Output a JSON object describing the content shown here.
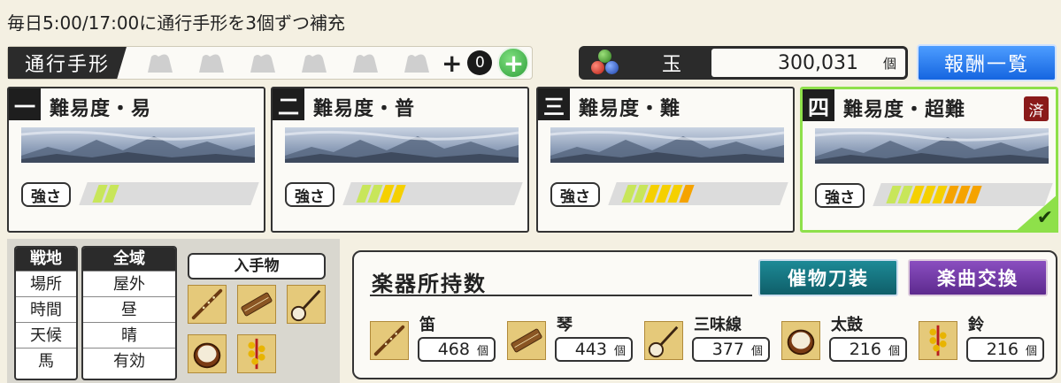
{
  "notice": "毎日5:00/17:00に通行手形を3個ずつ補充",
  "pass": {
    "label": "通行手形",
    "slots": 6,
    "plus": "+",
    "count": "0",
    "add_symbol": "+"
  },
  "jewel": {
    "label": "玉",
    "value": "300,031",
    "unit": "個"
  },
  "reward_button": "報酬一覧",
  "difficulties": [
    {
      "num": "一",
      "title": "難易度・易",
      "strength_label": "強さ",
      "level": 2,
      "done": false
    },
    {
      "num": "二",
      "title": "難易度・普",
      "strength_label": "強さ",
      "level": 4,
      "done": false
    },
    {
      "num": "三",
      "title": "難易度・難",
      "strength_label": "強さ",
      "level": 6,
      "done": false
    },
    {
      "num": "四",
      "title": "難易度・超難",
      "strength_label": "強さ",
      "level": 8,
      "done": true,
      "done_label": "済",
      "check": "✔"
    }
  ],
  "info": {
    "left_col": {
      "header": "戦地",
      "rows": [
        "場所",
        "時間",
        "天候",
        "馬"
      ]
    },
    "right_col": {
      "header": "全域",
      "rows": [
        "屋外",
        "昼",
        "晴",
        "有効"
      ]
    },
    "items_header": "入手物",
    "items": [
      "flute-icon",
      "koto-icon",
      "shamisen-icon",
      "taiko-icon",
      "bell-icon"
    ]
  },
  "instruments_panel": {
    "title": "楽器所持数",
    "prop_button": "催物刀装",
    "song_button": "楽曲交換",
    "items": [
      {
        "name": "笛",
        "count": "468",
        "unit": "個",
        "icon": "flute-icon"
      },
      {
        "name": "琴",
        "count": "443",
        "unit": "個",
        "icon": "koto-icon"
      },
      {
        "name": "三味線",
        "count": "377",
        "unit": "個",
        "icon": "shamisen-icon"
      },
      {
        "name": "太鼓",
        "count": "216",
        "unit": "個",
        "icon": "taiko-icon"
      },
      {
        "name": "鈴",
        "count": "216",
        "unit": "個",
        "icon": "bell-icon"
      }
    ]
  },
  "colors": {
    "meter_green": "#c8e65a",
    "meter_yellow": "#f5d000",
    "meter_orange": "#f5a300",
    "done_border": "#8ee04a"
  }
}
